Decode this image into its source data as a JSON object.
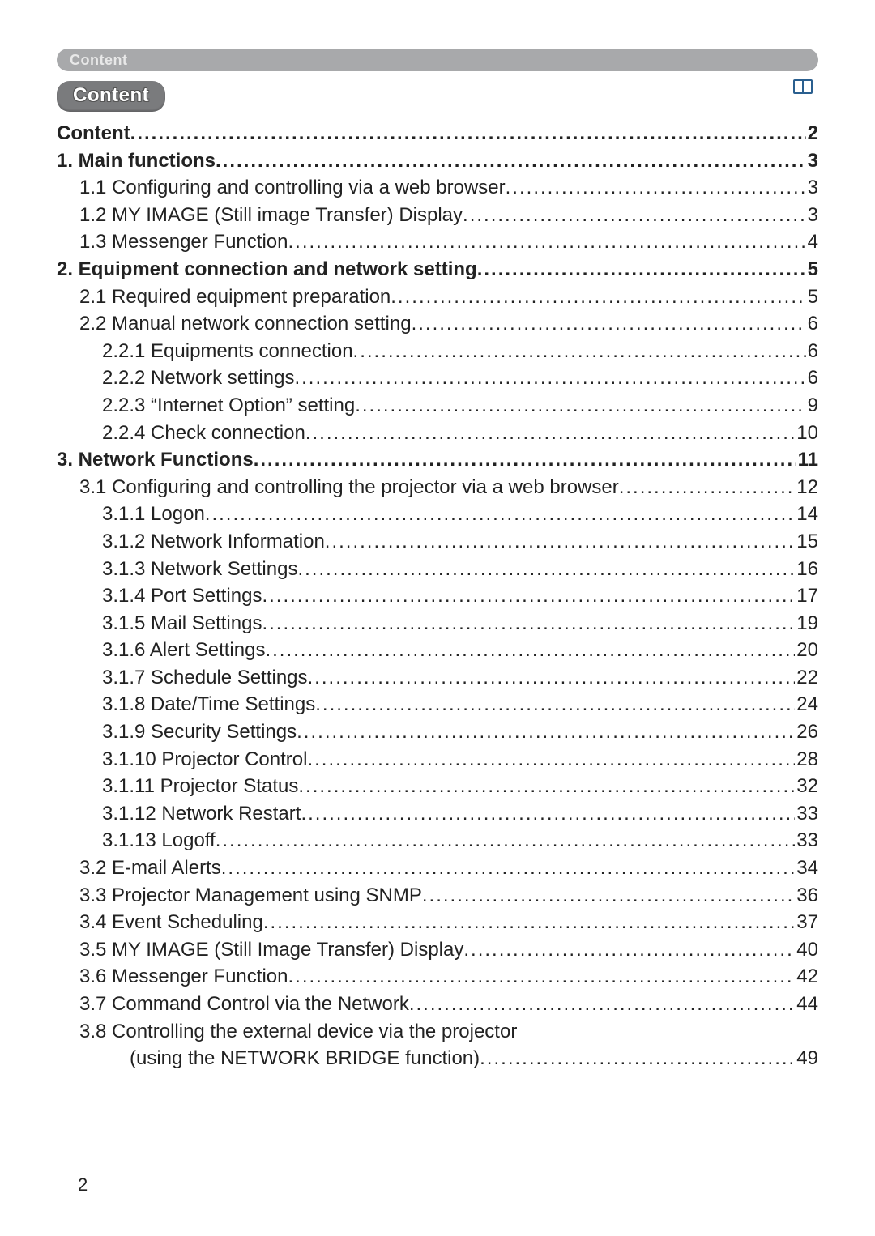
{
  "header": {
    "breadcrumb": "Content",
    "title": "Content"
  },
  "icon": {
    "book": "book-icon"
  },
  "toc": {
    "items": [
      {
        "level": 0,
        "label": "Content",
        "page": "2"
      },
      {
        "level": 0,
        "label": "1. Main functions",
        "page": "3"
      },
      {
        "level": 1,
        "label": "1.1 Configuring and controlling via a web browser",
        "page": "3"
      },
      {
        "level": 1,
        "label": "1.2 MY IMAGE (Still image Transfer) Display",
        "page": "3"
      },
      {
        "level": 1,
        "label": "1.3 Messenger Function",
        "page": "4"
      },
      {
        "level": 0,
        "label": "2. Equipment connection and network setting",
        "page": "5"
      },
      {
        "level": 1,
        "label": "2.1 Required equipment preparation",
        "page": "5"
      },
      {
        "level": 1,
        "label": "2.2 Manual network connection setting",
        "page": "6"
      },
      {
        "level": 2,
        "label": "2.2.1 Equipments connection",
        "page": "6"
      },
      {
        "level": 2,
        "label": "2.2.2 Network settings",
        "page": "6"
      },
      {
        "level": 2,
        "label": "2.2.3 “Internet Option” setting",
        "page": "9"
      },
      {
        "level": 2,
        "label": "2.2.4 Check connection",
        "page": "10"
      },
      {
        "level": 0,
        "label": "3. Network Functions",
        "page": "11"
      },
      {
        "level": 1,
        "label": "3.1 Configuring and controlling the projector via a web browser",
        "page": "12"
      },
      {
        "level": 2,
        "label": "3.1.1 Logon",
        "page": "14"
      },
      {
        "level": 2,
        "label": "3.1.2 Network Information",
        "page": "15"
      },
      {
        "level": 2,
        "label": "3.1.3 Network Settings",
        "page": "16"
      },
      {
        "level": 2,
        "label": "3.1.4 Port Settings",
        "page": "17"
      },
      {
        "level": 2,
        "label": "3.1.5 Mail Settings",
        "page": "19"
      },
      {
        "level": 2,
        "label": "3.1.6 Alert Settings",
        "page": "20"
      },
      {
        "level": 2,
        "label": "3.1.7 Schedule Settings",
        "page": "22"
      },
      {
        "level": 2,
        "label": "3.1.8 Date/Time Settings",
        "page": "24"
      },
      {
        "level": 2,
        "label": "3.1.9 Security Settings",
        "page": "26"
      },
      {
        "level": 2,
        "label": "3.1.10 Projector Control",
        "page": "28"
      },
      {
        "level": 2,
        "label": "3.1.11 Projector Status",
        "page": "32"
      },
      {
        "level": 2,
        "label": "3.1.12 Network Restart",
        "page": "33"
      },
      {
        "level": 2,
        "label": "3.1.13 Logoff",
        "page": "33"
      },
      {
        "level": 1,
        "label": "3.2 E-mail Alerts",
        "page": "34"
      },
      {
        "level": 1,
        "label": "3.3 Projector Management using SNMP",
        "page": "36"
      },
      {
        "level": 1,
        "label": "3.4 Event Scheduling",
        "page": "37"
      },
      {
        "level": 1,
        "label": "3.5 MY IMAGE (Still Image Transfer) Display",
        "page": "40"
      },
      {
        "level": 1,
        "label": "3.6 Messenger Function",
        "page": "42"
      },
      {
        "level": 1,
        "label": "3.7 Command Control via the Network",
        "page": "44"
      }
    ],
    "wrapped": {
      "line1": "3.8 Controlling the external device via the projector",
      "line2": "(using the NETWORK BRIDGE function)",
      "page": "49"
    }
  },
  "pageNumber": "2"
}
